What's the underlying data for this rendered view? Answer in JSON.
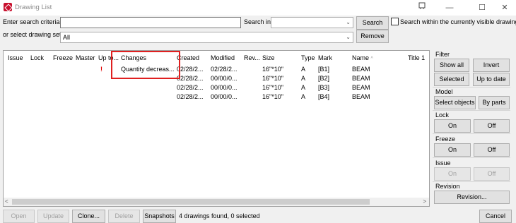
{
  "window": {
    "title": "Drawing List",
    "minimize": "—",
    "maximize": "☐",
    "close": "✕",
    "pin_icon": "pin-icon"
  },
  "search": {
    "criteria_label": "Enter search criteria:",
    "criteria_value": "",
    "search_in_label": "Search in",
    "search_in_value": "",
    "search_button": "Search",
    "visible_only_label": "Search within the currently visible drawings",
    "drawing_set_label": "or select drawing set",
    "drawing_set_value": "All",
    "remove_button": "Remove"
  },
  "table": {
    "columns": [
      "Issue",
      "Lock",
      "Freeze",
      "Master",
      "Up to...",
      "Changes",
      "Created",
      "Modified",
      "Rev...",
      "Size",
      "Type",
      "Mark",
      "Name",
      "Title 1"
    ],
    "sort_indicator": "^",
    "rows": [
      {
        "uptodate": "!",
        "changes": "Quantity decreas...",
        "created": "02/28/2...",
        "modified": "02/28/2...",
        "size": "16\"*10\"",
        "type": "A",
        "mark": "[B1]",
        "name": "BEAM"
      },
      {
        "uptodate": "",
        "changes": "",
        "created": "02/28/2...",
        "modified": "00/00/0...",
        "size": "16\"*10\"",
        "type": "A",
        "mark": "[B2]",
        "name": "BEAM"
      },
      {
        "uptodate": "",
        "changes": "",
        "created": "02/28/2...",
        "modified": "00/00/0...",
        "size": "16\"*10\"",
        "type": "A",
        "mark": "[B3]",
        "name": "BEAM"
      },
      {
        "uptodate": "",
        "changes": "",
        "created": "02/28/2...",
        "modified": "00/00/0...",
        "size": "16\"*10\"",
        "type": "A",
        "mark": "[B4]",
        "name": "BEAM"
      }
    ]
  },
  "sidebar": {
    "filter_label": "Filter",
    "show_all": "Show all",
    "invert": "Invert",
    "selected": "Selected",
    "up_to_date": "Up to date",
    "model_label": "Model",
    "select_objects": "Select objects",
    "by_parts": "By parts",
    "lock_label": "Lock",
    "lock_on": "On",
    "lock_off": "Off",
    "freeze_label": "Freeze",
    "freeze_on": "On",
    "freeze_off": "Off",
    "issue_label": "Issue",
    "issue_on": "On",
    "issue_off": "Off",
    "revision_label": "Revision",
    "revision_button": "Revision..."
  },
  "footer": {
    "open": "Open",
    "update": "Update",
    "clone": "Clone...",
    "delete": "Delete",
    "snapshots": "Snapshots",
    "status": "4 drawings found, 0 selected",
    "cancel": "Cancel"
  },
  "colors": {
    "highlight_box": "#e02020",
    "warning": "#e00000",
    "brand_icon": "#c8102e"
  }
}
